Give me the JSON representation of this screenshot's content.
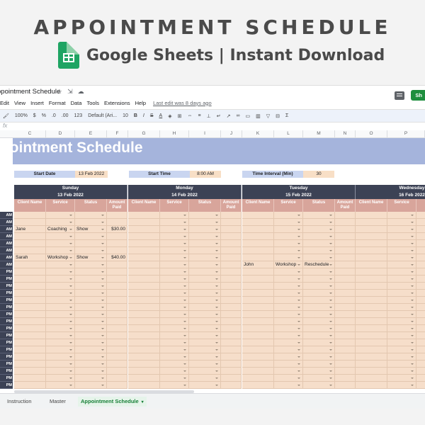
{
  "banner": {
    "title": "APPOINTMENT SCHEDULE",
    "subtitle": "Google Sheets | Instant Download",
    "logo_icon": "google-sheets-icon"
  },
  "window": {
    "doc_title": "ppointment Schedule",
    "menu": [
      "Edit",
      "View",
      "Insert",
      "Format",
      "Data",
      "Tools",
      "Extensions",
      "Help"
    ],
    "last_edit": "Last edit was 8 days ago",
    "share_label": "Sh",
    "toolbar": {
      "zoom": "100%",
      "currency": "$",
      "percent": "%",
      "dec_less": ".0",
      "dec_more": ".00",
      "number_format": "123",
      "font": "Default (Ari...",
      "font_size": "10",
      "bold": "B",
      "italic": "I",
      "strike": "S",
      "text_color": "A"
    },
    "formula_prefix": "fx",
    "col_headers": [
      "C",
      "D",
      "E",
      "F",
      "G",
      "H",
      "I",
      "J",
      "K",
      "L",
      "M",
      "N",
      "O",
      "P"
    ]
  },
  "sheet": {
    "title": "ppointment Schedule",
    "start_date_label": "Start Date",
    "start_date": "13 Feb 2022",
    "start_time_label": "Start Time",
    "start_time": "8:00 AM",
    "interval_label": "Time Interval (Min)",
    "interval": "30",
    "days": [
      {
        "name": "Sunday",
        "date": "13 Feb 2022"
      },
      {
        "name": "Monday",
        "date": "14 Feb 2022"
      },
      {
        "name": "Tuesday",
        "date": "15 Feb 2022"
      },
      {
        "name": "Wednesday",
        "date": "16 Feb 2022"
      }
    ],
    "columns": [
      "Client Name",
      "Service",
      "Status",
      "Amount Paid"
    ],
    "time_rows": [
      "AM",
      "AM",
      "AM",
      "AM",
      "AM",
      "AM",
      "AM",
      "AM",
      "PM",
      "PM",
      "PM",
      "PM",
      "PM",
      "PM",
      "PM",
      "PM",
      "PM",
      "PM",
      "PM",
      "PM",
      "PM",
      "PM",
      "PM",
      "PM",
      "PM"
    ],
    "entries": [
      {
        "row": 2,
        "day": 0,
        "client": "Jane",
        "service": "Coaching",
        "status": "Show",
        "amount": "$30.00"
      },
      {
        "row": 6,
        "day": 0,
        "client": "Sarah",
        "service": "Workshop",
        "status": "Show",
        "amount": "$40.00"
      },
      {
        "row": 7,
        "day": 2,
        "client": "John",
        "service": "Workshop",
        "status": "Reschedule",
        "amount": ""
      }
    ]
  },
  "tabs": [
    {
      "label": "Instruction"
    },
    {
      "label": "Master"
    },
    {
      "label": "Appointment Schedule"
    }
  ],
  "colors": {
    "title_band": "#a5b4dc",
    "day_header": "#3c4255",
    "sub_header": "#d8a59b",
    "cell": "#f6deca",
    "share": "#1e8e3e"
  }
}
